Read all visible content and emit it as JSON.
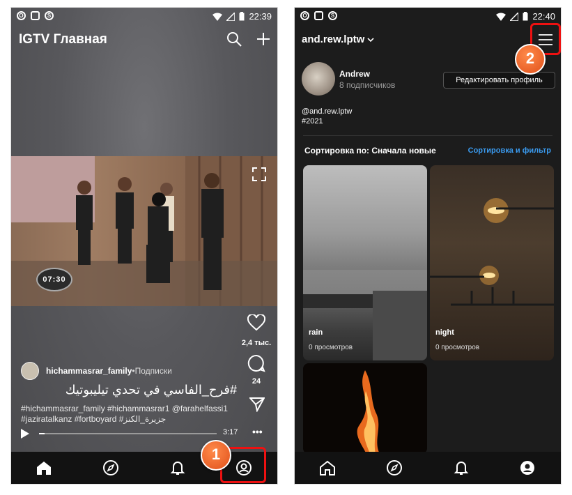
{
  "left": {
    "status": {
      "time": "22:39"
    },
    "header": {
      "title": "IGTV Главная"
    },
    "video": {
      "logo_text": "07:30"
    },
    "actions": {
      "likes": "2,4 тыс.",
      "comments": "24"
    },
    "author": {
      "username": "hichammasrar_family",
      "separator": " • ",
      "follow_label": "Подписки"
    },
    "caption": "#فرح_الفاسي في تحدي تيليبوتيك",
    "hashtags_line1": "#hichammasrar_family #hichammasrar1 @farahelfassi1",
    "hashtags_line2": "#jaziratalkanz #fortboyard #جزيرة_الكنز",
    "player": {
      "duration": "3:17",
      "progress": 0.03
    },
    "nav": [
      "home-icon",
      "explore-icon",
      "bell-icon",
      "profile-icon"
    ],
    "annotation_badge": "1"
  },
  "right": {
    "status": {
      "time": "22:40"
    },
    "header": {
      "username": "and.rew.lptw"
    },
    "profile": {
      "name": "Andrew",
      "followers": "8 подписчиков",
      "edit_label": "Редактировать профиль"
    },
    "bio": {
      "line1": "@and.rew.lptw",
      "line2": "#2021"
    },
    "sort": {
      "label": "Сортировка по: Сначала новые",
      "filter_link": "Сортировка и фильтр"
    },
    "videos": [
      {
        "title": "rain",
        "views": "0 просмотров"
      },
      {
        "title": "night",
        "views": "0 просмотров"
      },
      {
        "title": "",
        "views": ""
      }
    ],
    "nav": [
      "home-icon",
      "explore-icon",
      "bell-icon",
      "profile-icon"
    ],
    "annotation_badge": "2"
  },
  "colors": {
    "accent_red": "#ee1111",
    "badge_orange": "#e8561e",
    "link_blue": "#3a9bf0"
  }
}
